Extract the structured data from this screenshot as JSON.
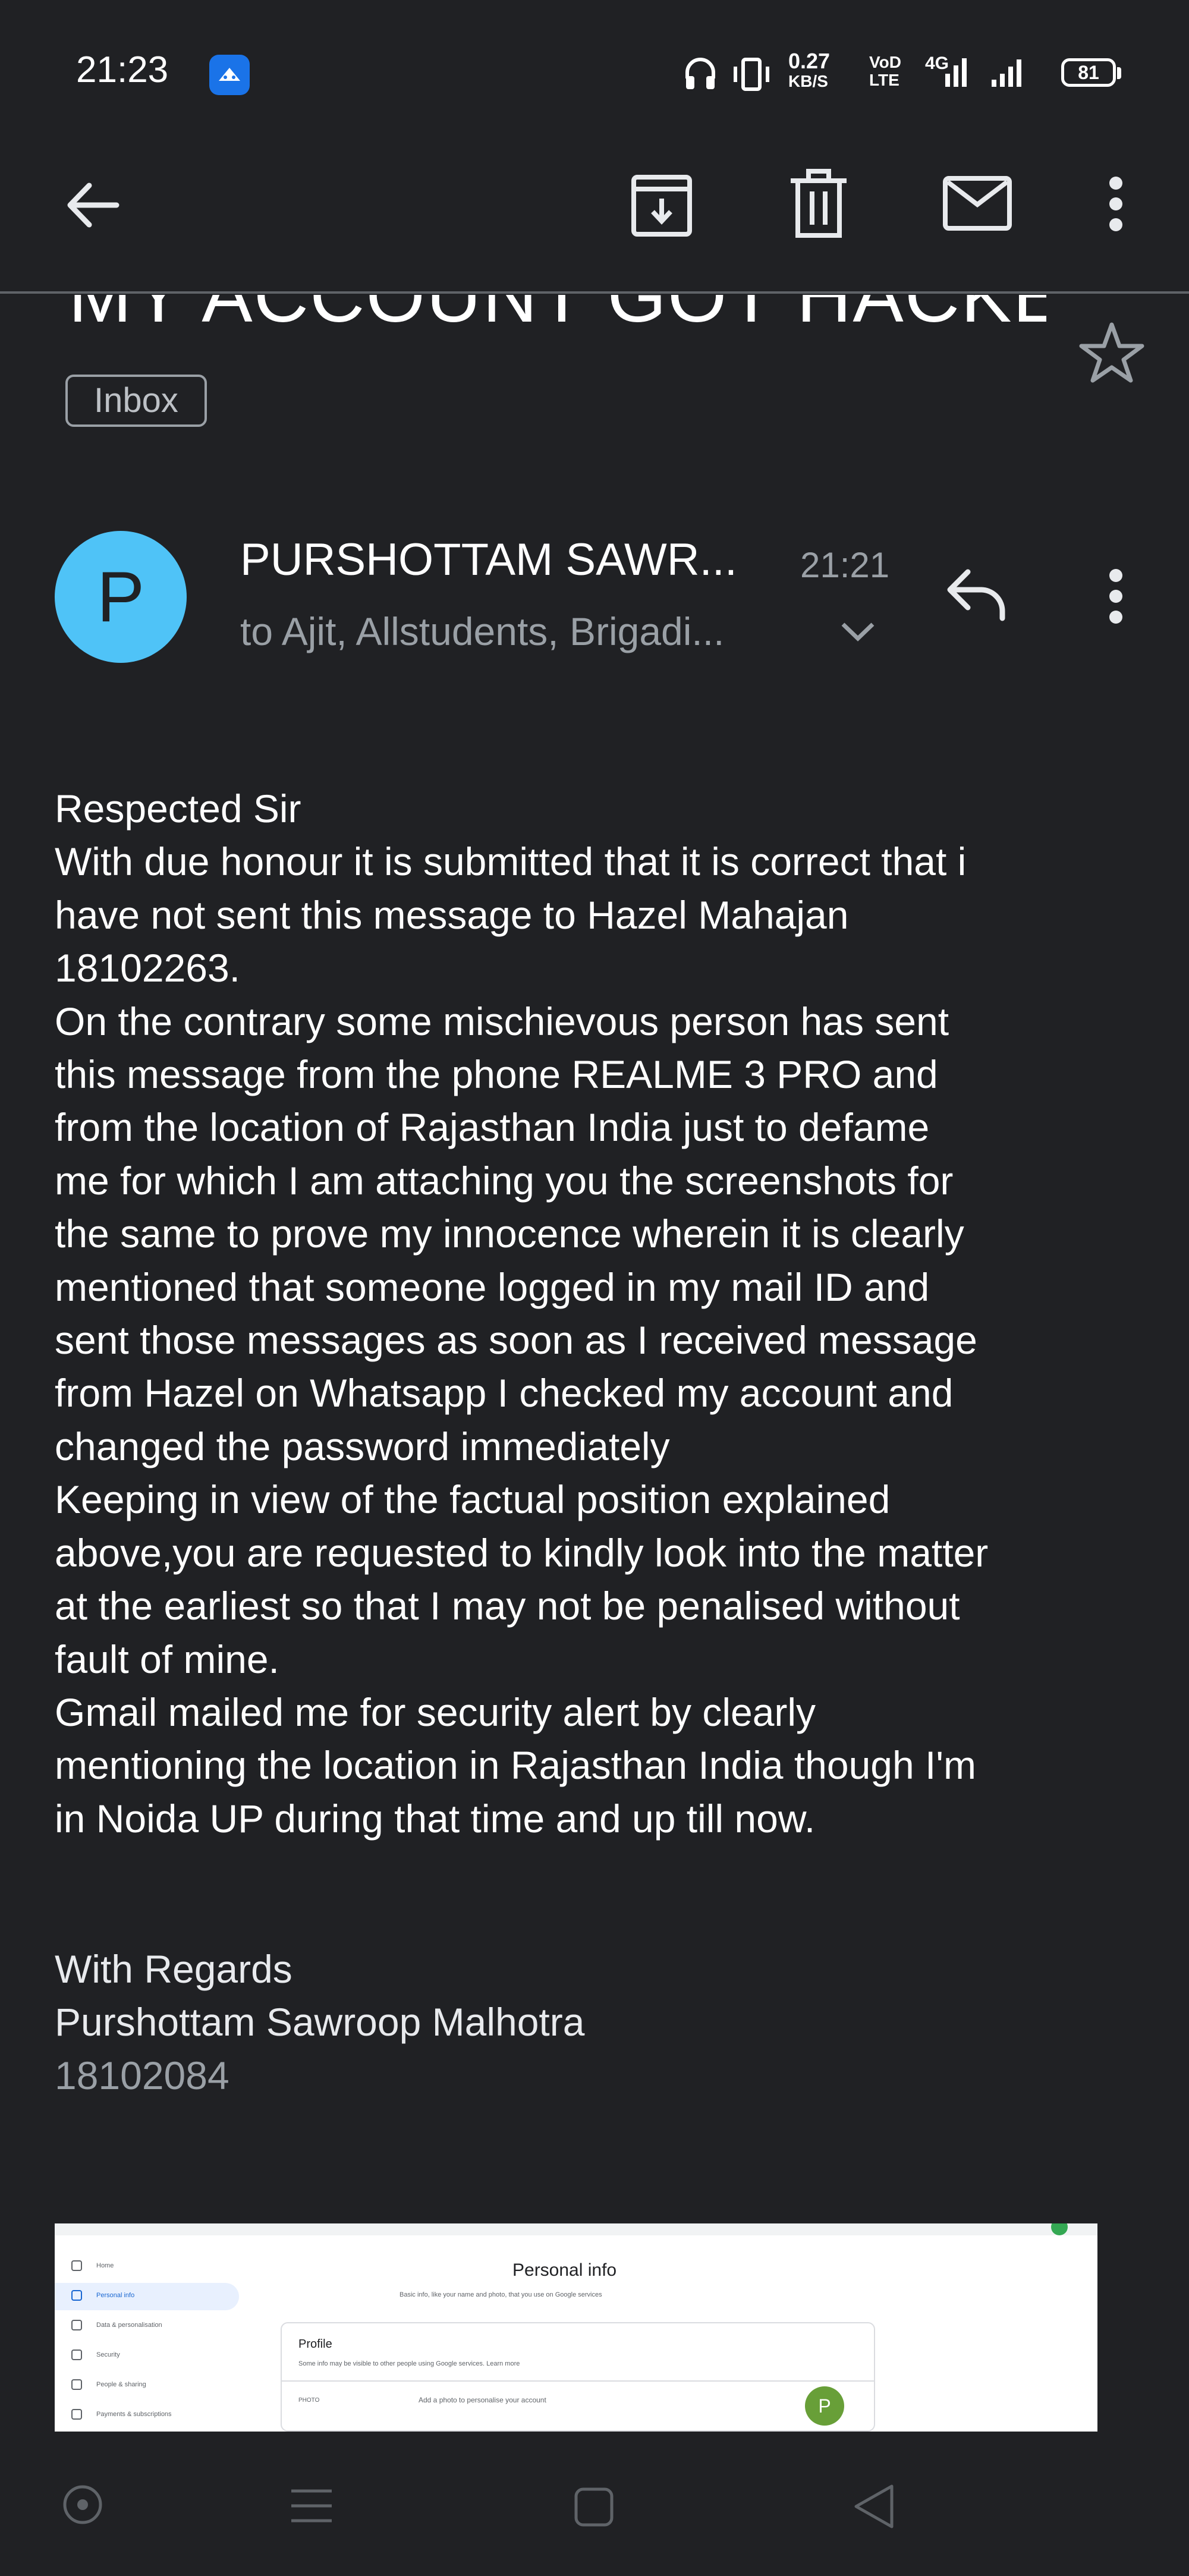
{
  "status_bar": {
    "time": "21:23",
    "network_speed_value": "0.27",
    "network_speed_unit": "KB/S",
    "volte_top": "VoD",
    "volte_bottom": "LTE",
    "network_type": "4G",
    "battery": "81",
    "icons": [
      "notification-app-icon",
      "headphones-icon",
      "vibrate-icon",
      "signal-icon",
      "battery-icon"
    ]
  },
  "toolbar": {
    "icons": [
      "back-arrow-icon",
      "archive-icon",
      "delete-icon",
      "mark-unread-icon",
      "more-vert-icon"
    ]
  },
  "email": {
    "subject": "MY ACCOUNT GOT HACKED",
    "label": "Inbox",
    "sender_initial": "P",
    "sender_name": "PURSHOTTAM SAWR...",
    "time": "21:21",
    "recipients": "to Ajit, Allstudents, Brigadi...",
    "body_lines": [
      "Respected Sir",
      "With due honour it is submitted that it is correct that i",
      "have not sent this message to Hazel Mahajan",
      "18102263.",
      "On the contrary some mischievous person has sent",
      "this message from the phone REALME 3 PRO and",
      "from the location of Rajasthan India just to defame",
      "me for which I am attaching you the screenshots for",
      "the same to prove my innocence wherein it is clearly",
      "mentioned that someone logged in my mail ID and",
      "sent those messages as soon as I received message",
      "from Hazel on Whatsapp I checked my account and",
      "changed the password immediately",
      "Keeping in view of the factual position explained",
      "above,you are requested to kindly look into the matter",
      "at the earliest so that I may not be penalised without",
      "fault of mine.",
      "Gmail mailed me for security alert by clearly",
      "mentioning the location in Rajasthan India though  I'm",
      "in Noida UP during that time and up till now."
    ],
    "closing": "With Regards",
    "signature_name": "Purshottam Sawroop Malhotra",
    "signature_id": "18102084"
  },
  "attachment": {
    "title": "Personal info",
    "subtitle": "Basic info, like your name and photo, that you use on Google services",
    "section": "Profile",
    "section_desc": "Some info may be visible to other people using Google services. Learn more",
    "photo_label": "PHOTO",
    "photo_desc": "Add a photo to personalise your account",
    "avatar_initial": "P",
    "nav_items": [
      "Home",
      "Personal info",
      "Data & personalisation",
      "Security",
      "People & sharing",
      "Payments & subscriptions"
    ]
  },
  "nav_bar": {
    "icons": [
      "assistant-icon",
      "recents-icon",
      "home-icon",
      "back-icon"
    ]
  }
}
